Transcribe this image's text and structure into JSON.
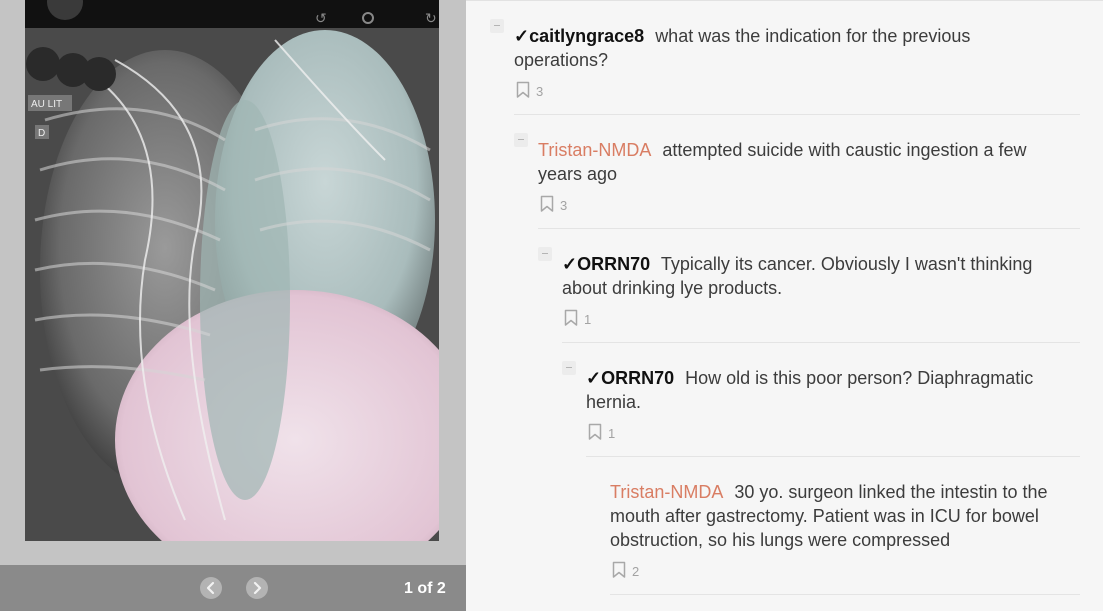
{
  "viewer": {
    "page_counter": "1 of 2",
    "image_overlay_labels": [
      "AU LIT",
      "D"
    ]
  },
  "comments": [
    {
      "check": "✓",
      "author": "caitlyngrace8",
      "is_op": false,
      "text": "what was the indication for the previous operations?",
      "saves": "3"
    },
    {
      "check": "",
      "author": "Tristan-NMDA",
      "is_op": true,
      "text": "attempted suicide with caustic ingestion a few years ago",
      "saves": "3"
    },
    {
      "check": "✓",
      "author": "ORRN70",
      "is_op": false,
      "text": "Typically its cancer. Obviously I wasn't thinking about drinking lye products.",
      "saves": "1"
    },
    {
      "check": "✓",
      "author": "ORRN70",
      "is_op": false,
      "text": "How old is this poor person? Diaphragmatic hernia.",
      "saves": "1"
    },
    {
      "check": "",
      "author": "Tristan-NMDA",
      "is_op": true,
      "text": "30 yo. surgeon linked the intestin to the mouth after gastrectomy. Patient was in ICU for bowel obstruction, so his lungs were compressed",
      "saves": "2"
    }
  ]
}
